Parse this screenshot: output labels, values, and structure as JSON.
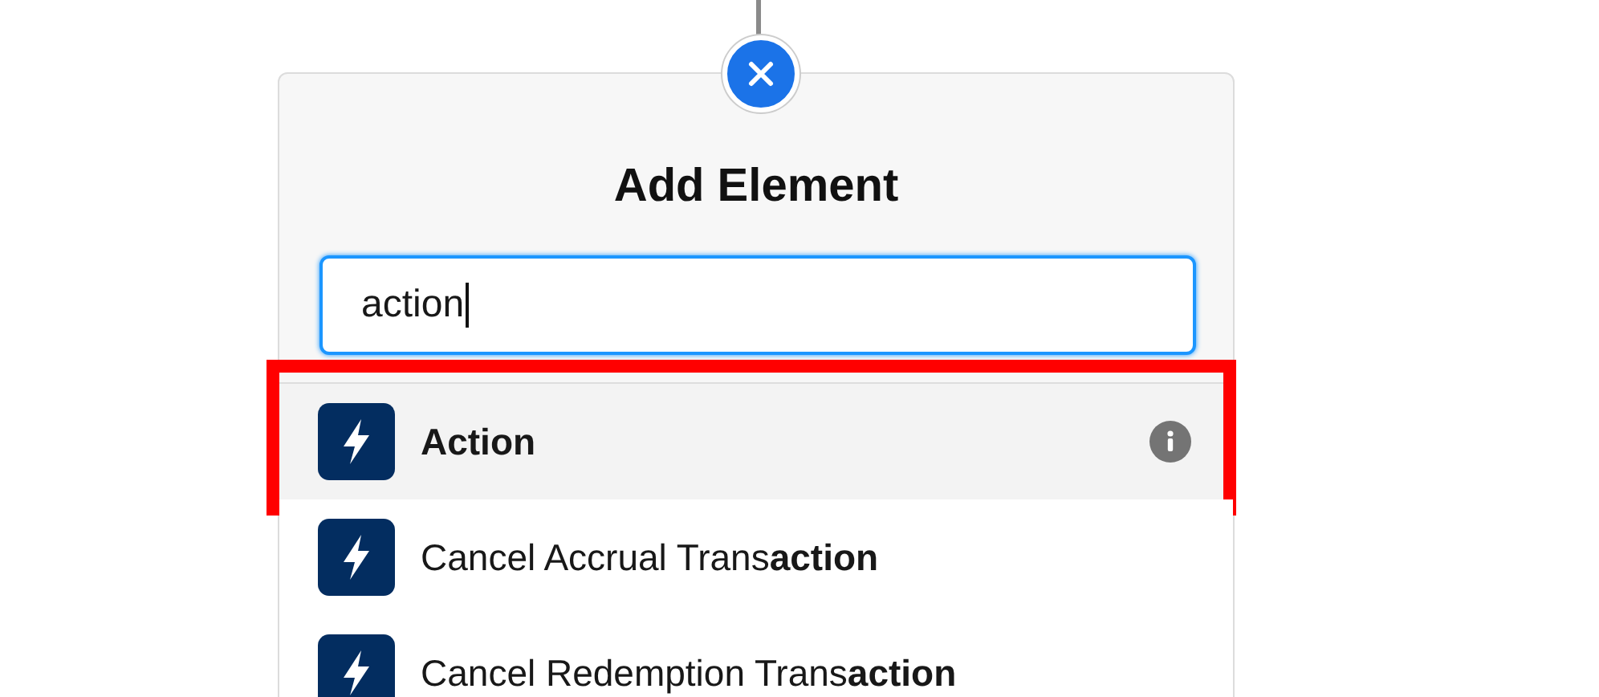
{
  "dialog": {
    "title": "Add Element",
    "search": {
      "value": "action"
    }
  },
  "results": [
    {
      "label": "**Action**",
      "selected": true,
      "info": true
    },
    {
      "label": "Cancel Accrual Trans**action**",
      "selected": false,
      "info": false
    },
    {
      "label": "Cancel Redemption Trans**action**",
      "selected": false,
      "info": false
    }
  ]
}
